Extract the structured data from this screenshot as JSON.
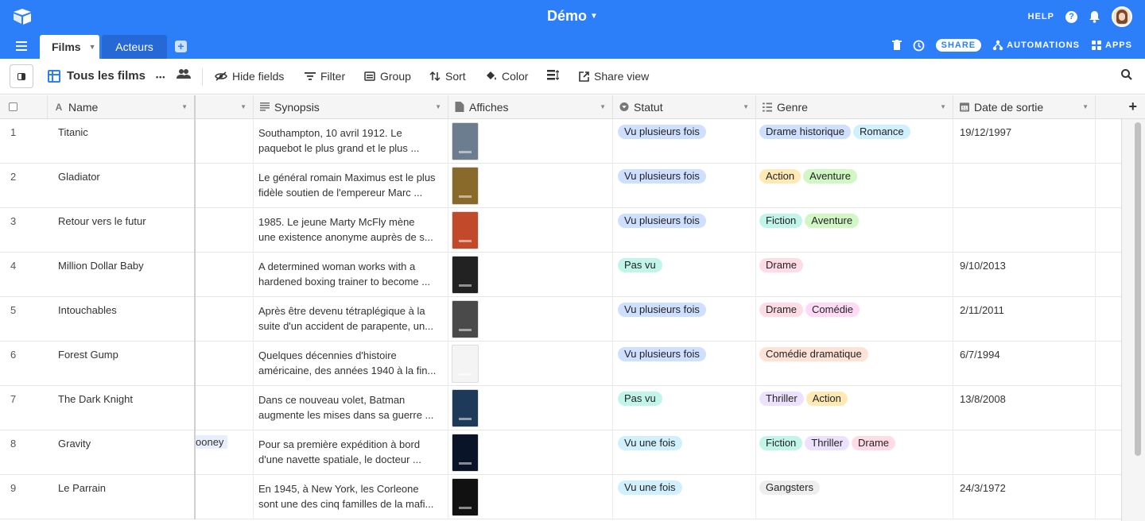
{
  "header": {
    "base_title": "Démo",
    "help_label": "HELP",
    "help_icon": "?"
  },
  "tabs": {
    "active": "Films",
    "second": "Acteurs",
    "add": "+"
  },
  "tabs_right": {
    "share": "SHARE",
    "automations": "AUTOMATIONS",
    "apps": "APPS"
  },
  "viewbar": {
    "view_name": "Tous les films",
    "more": "•••",
    "hide_fields": "Hide fields",
    "filter": "Filter",
    "group": "Group",
    "sort": "Sort",
    "color": "Color",
    "share_view": "Share view"
  },
  "columns": {
    "name": "Name",
    "synopsis": "Synopsis",
    "affiches": "Affiches",
    "statut": "Statut",
    "genre": "Genre",
    "date": "Date de sortie",
    "add": "+"
  },
  "rows": [
    {
      "num": "1",
      "name": "Titanic",
      "syn1": "Southampton, 10 avril 1912. Le",
      "syn2": "paquebot le plus grand et le plus ...",
      "statut": "Vu plusieurs fois",
      "genres": [
        "Drame historique",
        "Romance"
      ],
      "date": "19/12/1997",
      "poster": "#6b7d8e"
    },
    {
      "num": "2",
      "name": "Gladiator",
      "syn1": "Le général romain Maximus est le plus",
      "syn2": "fidèle soutien de l'empereur Marc ...",
      "statut": "Vu plusieurs fois",
      "genres": [
        "Action",
        "Aventure"
      ],
      "date": "",
      "poster": "#8a6a2a"
    },
    {
      "num": "3",
      "name": "Retour vers le futur",
      "syn1": " 1985. Le jeune Marty McFly mène",
      "syn2": "une existence anonyme auprès de s...",
      "statut": "Vu plusieurs fois",
      "genres": [
        "Fiction",
        "Aventure"
      ],
      "date": "",
      "poster": "#c24a2a"
    },
    {
      "num": "4",
      "name": "Million Dollar Baby",
      "syn1": "A determined woman works with a",
      "syn2": "hardened boxing trainer to become ...",
      "statut": "Pas vu",
      "genres": [
        "Drame"
      ],
      "date": "9/10/2013",
      "poster": "#222222"
    },
    {
      "num": "5",
      "name": "Intouchables",
      "syn1": "Après être devenu tétraplégique à la",
      "syn2": "suite d'un accident de parapente, un...",
      "statut": "Vu plusieurs fois",
      "genres": [
        "Drame",
        "Comédie"
      ],
      "date": "2/11/2011",
      "poster": "#4a4a4a"
    },
    {
      "num": "6",
      "name": "Forest Gump",
      "syn1": "Quelques décennies d'histoire",
      "syn2": "américaine, des années 1940 à la fin...",
      "statut": "Vu plusieurs fois",
      "genres": [
        "Comédie dramatique"
      ],
      "date": "6/7/1994",
      "poster": "#f4f4f4"
    },
    {
      "num": "7",
      "name": "The Dark Knight",
      "syn1": "Dans ce nouveau volet, Batman",
      "syn2": "augmente les mises dans sa guerre ...",
      "statut": "Pas vu",
      "genres": [
        "Thriller",
        "Action"
      ],
      "date": "13/8/2008",
      "poster": "#1e3a5a"
    },
    {
      "num": "8",
      "name": "Gravity",
      "syn1": "Pour sa première expédition à bord",
      "syn2": "d'une navette spatiale, le docteur ...",
      "statut": "Vu une fois",
      "genres": [
        "Fiction",
        "Thriller",
        "Drame"
      ],
      "date": "",
      "poster": "#0a1428",
      "actor": "ooney"
    },
    {
      "num": "9",
      "name": "Le Parrain",
      "syn1": "En 1945, à New York, les Corleone",
      "syn2": "sont une des cinq familles de la mafi...",
      "statut": "Vu une fois",
      "genres": [
        "Gangsters"
      ],
      "date": "24/3/1972",
      "poster": "#111111"
    }
  ],
  "colors": {
    "Vu plusieurs fois": "#cfdfff",
    "Pas vu": "#c2f5e9",
    "Vu une fois": "#d0f0fd",
    "Drame historique": "#cfdfff",
    "Romance": "#d0f0fd",
    "Action": "#ffeab6",
    "Aventure": "#d1f7c4",
    "Fiction": "#c2f5e9",
    "Drame": "#ffdce5",
    "Comédie": "#ffdaf6",
    "Comédie dramatique": "#fee2d5",
    "Thriller": "#ede2fe",
    "Gangsters": "#eeeeee"
  }
}
